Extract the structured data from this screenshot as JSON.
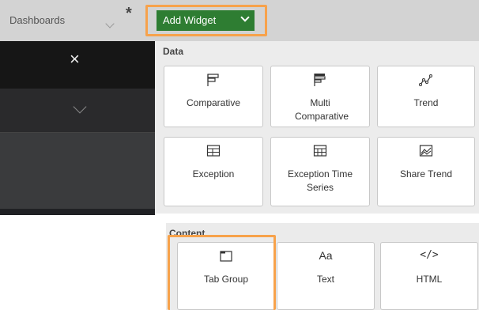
{
  "header": {
    "breadcrumb": "Dashboards",
    "modified_marker": "*",
    "add_widget_label": "Add Widget"
  },
  "sidebar": {
    "close_icon": "×"
  },
  "data_section": {
    "title": "Data",
    "items": [
      {
        "label": "Comparative",
        "icon": "comparative-icon"
      },
      {
        "label": "Multi Comparative",
        "icon": "multi-comparative-icon"
      },
      {
        "label": "Trend",
        "icon": "trend-icon"
      },
      {
        "label": "Exception",
        "icon": "exception-icon"
      },
      {
        "label": "Exception Time Series",
        "icon": "exception-time-series-icon"
      },
      {
        "label": "Share Trend",
        "icon": "share-trend-icon"
      }
    ]
  },
  "content_section": {
    "title": "Content",
    "items": [
      {
        "label": "Tab Group",
        "icon": "tab-group-icon"
      },
      {
        "label": "Text",
        "icon": "text-icon",
        "glyph": "Aa"
      },
      {
        "label": "HTML",
        "icon": "html-icon",
        "glyph": "</>"
      }
    ]
  },
  "colors": {
    "accent_green": "#2e7d32",
    "highlight_orange": "#f7a24b",
    "sidebar_dark": "#202124"
  }
}
